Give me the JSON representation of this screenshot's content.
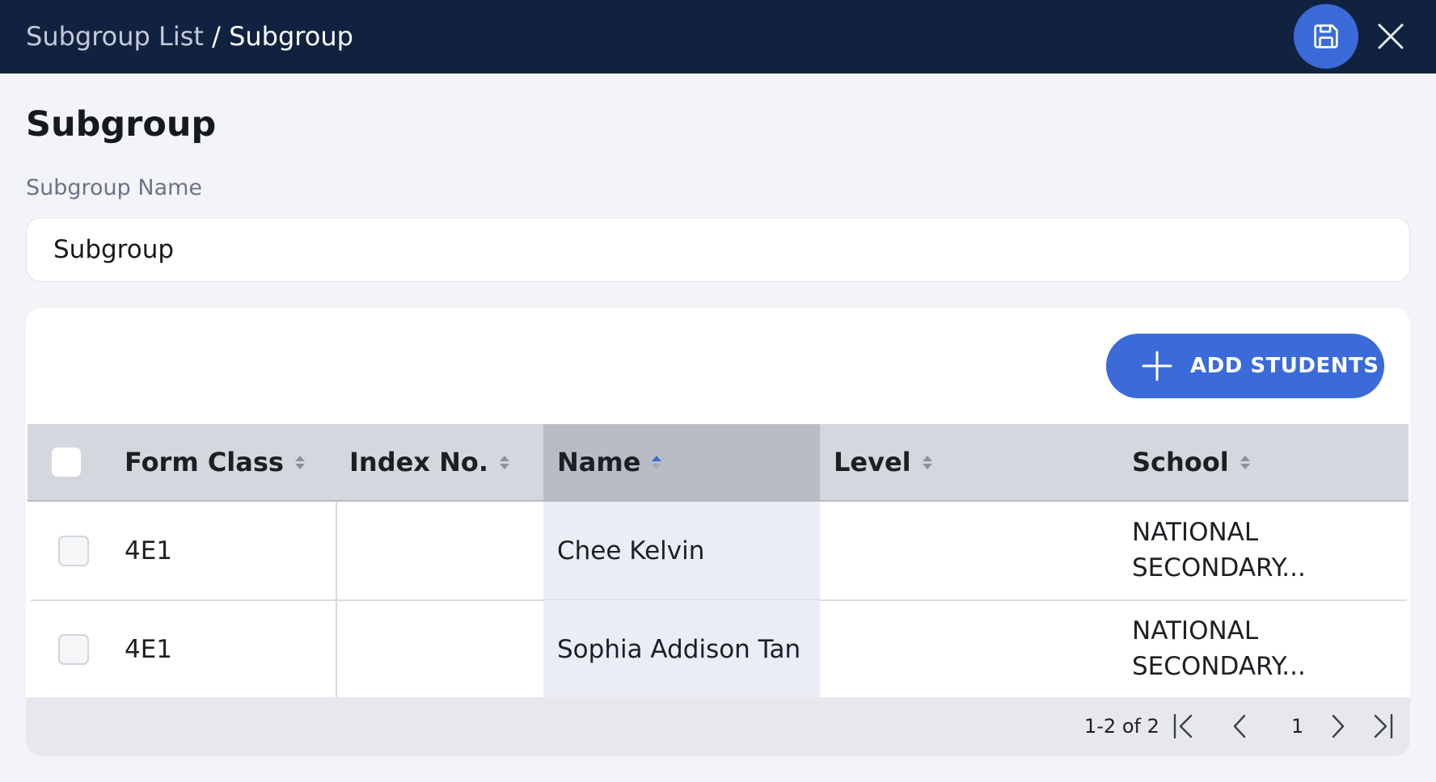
{
  "header": {
    "breadcrumb_parent": "Subgroup List",
    "breadcrumb_separator": " / ",
    "breadcrumb_current": "Subgroup",
    "save_icon": "save-icon",
    "close_icon": "close-icon"
  },
  "page": {
    "title": "Subgroup",
    "field_label": "Subgroup Name",
    "field_value": "Subgroup"
  },
  "toolbar": {
    "add_students_label": "ADD STUDENTS",
    "add_icon": "plus-icon"
  },
  "table": {
    "columns": [
      {
        "label": "Form Class",
        "sort": "none"
      },
      {
        "label": "Index No.",
        "sort": "none"
      },
      {
        "label": "Name",
        "sort": "ascending"
      },
      {
        "label": "Level",
        "sort": "none"
      },
      {
        "label": "School",
        "sort": "none"
      }
    ],
    "rows": [
      {
        "form_class": "4E1",
        "index_no": "",
        "name": "Chee Kelvin",
        "level": "",
        "school_line1": "NATIONAL",
        "school_line2": "SECONDARY..."
      },
      {
        "form_class": "4E1",
        "index_no": "",
        "name": "Sophia Addison Tan",
        "level": "",
        "school_line1": "NATIONAL",
        "school_line2": "SECONDARY..."
      }
    ]
  },
  "pagination": {
    "range": "1-2 of 2",
    "current_page": "1"
  },
  "colors": {
    "header_bg": "#112240",
    "accent": "#3a6bd9",
    "table_header_bg": "#d4d7dd",
    "sorted_column_bg": "#eaedf8"
  }
}
